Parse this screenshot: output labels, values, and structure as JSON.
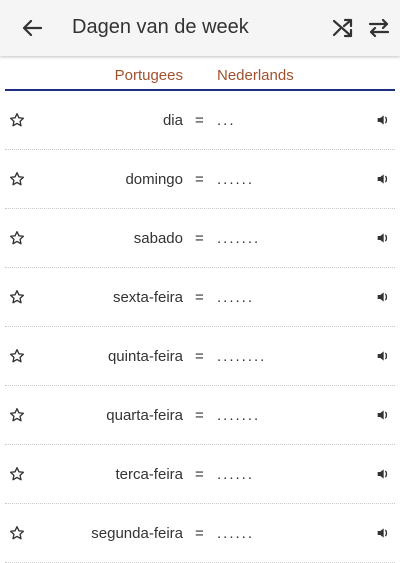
{
  "appbar": {
    "title": "Dagen van de week",
    "icons": {
      "back": "arrow-left-icon",
      "shuffle": "shuffle-icon",
      "swap": "swap-horizontal-icon"
    }
  },
  "columns": {
    "source": "Portugees",
    "target": "Nederlands"
  },
  "colors": {
    "accent": "#a0522d",
    "rule": "#1f2f80",
    "appbar": "#f5f5f5"
  },
  "rows": [
    {
      "word": "dia",
      "eq": "=",
      "answer": "..."
    },
    {
      "word": "domingo",
      "eq": "=",
      "answer": "......"
    },
    {
      "word": "sabado",
      "eq": "=",
      "answer": "......."
    },
    {
      "word": "sexta-feira",
      "eq": "=",
      "answer": "......"
    },
    {
      "word": "quinta-feira",
      "eq": "=",
      "answer": "........"
    },
    {
      "word": "quarta-feira",
      "eq": "=",
      "answer": "......."
    },
    {
      "word": "terca-feira",
      "eq": "=",
      "answer": "......"
    },
    {
      "word": "segunda-feira",
      "eq": "=",
      "answer": "......"
    }
  ]
}
